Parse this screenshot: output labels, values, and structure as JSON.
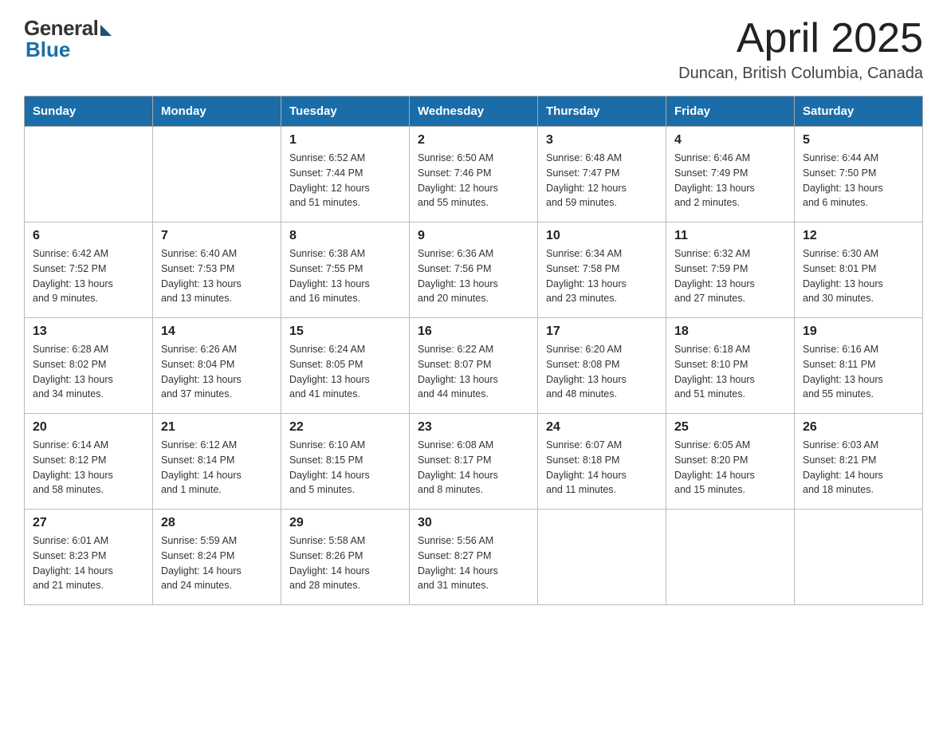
{
  "header": {
    "logo_general": "General",
    "logo_blue": "Blue",
    "title": "April 2025",
    "subtitle": "Duncan, British Columbia, Canada"
  },
  "weekdays": [
    "Sunday",
    "Monday",
    "Tuesday",
    "Wednesday",
    "Thursday",
    "Friday",
    "Saturday"
  ],
  "weeks": [
    [
      {
        "day": "",
        "sunrise": "",
        "sunset": "",
        "daylight": ""
      },
      {
        "day": "",
        "sunrise": "",
        "sunset": "",
        "daylight": ""
      },
      {
        "day": "1",
        "sunrise": "Sunrise: 6:52 AM",
        "sunset": "Sunset: 7:44 PM",
        "daylight": "Daylight: 12 hours and 51 minutes."
      },
      {
        "day": "2",
        "sunrise": "Sunrise: 6:50 AM",
        "sunset": "Sunset: 7:46 PM",
        "daylight": "Daylight: 12 hours and 55 minutes."
      },
      {
        "day": "3",
        "sunrise": "Sunrise: 6:48 AM",
        "sunset": "Sunset: 7:47 PM",
        "daylight": "Daylight: 12 hours and 59 minutes."
      },
      {
        "day": "4",
        "sunrise": "Sunrise: 6:46 AM",
        "sunset": "Sunset: 7:49 PM",
        "daylight": "Daylight: 13 hours and 2 minutes."
      },
      {
        "day": "5",
        "sunrise": "Sunrise: 6:44 AM",
        "sunset": "Sunset: 7:50 PM",
        "daylight": "Daylight: 13 hours and 6 minutes."
      }
    ],
    [
      {
        "day": "6",
        "sunrise": "Sunrise: 6:42 AM",
        "sunset": "Sunset: 7:52 PM",
        "daylight": "Daylight: 13 hours and 9 minutes."
      },
      {
        "day": "7",
        "sunrise": "Sunrise: 6:40 AM",
        "sunset": "Sunset: 7:53 PM",
        "daylight": "Daylight: 13 hours and 13 minutes."
      },
      {
        "day": "8",
        "sunrise": "Sunrise: 6:38 AM",
        "sunset": "Sunset: 7:55 PM",
        "daylight": "Daylight: 13 hours and 16 minutes."
      },
      {
        "day": "9",
        "sunrise": "Sunrise: 6:36 AM",
        "sunset": "Sunset: 7:56 PM",
        "daylight": "Daylight: 13 hours and 20 minutes."
      },
      {
        "day": "10",
        "sunrise": "Sunrise: 6:34 AM",
        "sunset": "Sunset: 7:58 PM",
        "daylight": "Daylight: 13 hours and 23 minutes."
      },
      {
        "day": "11",
        "sunrise": "Sunrise: 6:32 AM",
        "sunset": "Sunset: 7:59 PM",
        "daylight": "Daylight: 13 hours and 27 minutes."
      },
      {
        "day": "12",
        "sunrise": "Sunrise: 6:30 AM",
        "sunset": "Sunset: 8:01 PM",
        "daylight": "Daylight: 13 hours and 30 minutes."
      }
    ],
    [
      {
        "day": "13",
        "sunrise": "Sunrise: 6:28 AM",
        "sunset": "Sunset: 8:02 PM",
        "daylight": "Daylight: 13 hours and 34 minutes."
      },
      {
        "day": "14",
        "sunrise": "Sunrise: 6:26 AM",
        "sunset": "Sunset: 8:04 PM",
        "daylight": "Daylight: 13 hours and 37 minutes."
      },
      {
        "day": "15",
        "sunrise": "Sunrise: 6:24 AM",
        "sunset": "Sunset: 8:05 PM",
        "daylight": "Daylight: 13 hours and 41 minutes."
      },
      {
        "day": "16",
        "sunrise": "Sunrise: 6:22 AM",
        "sunset": "Sunset: 8:07 PM",
        "daylight": "Daylight: 13 hours and 44 minutes."
      },
      {
        "day": "17",
        "sunrise": "Sunrise: 6:20 AM",
        "sunset": "Sunset: 8:08 PM",
        "daylight": "Daylight: 13 hours and 48 minutes."
      },
      {
        "day": "18",
        "sunrise": "Sunrise: 6:18 AM",
        "sunset": "Sunset: 8:10 PM",
        "daylight": "Daylight: 13 hours and 51 minutes."
      },
      {
        "day": "19",
        "sunrise": "Sunrise: 6:16 AM",
        "sunset": "Sunset: 8:11 PM",
        "daylight": "Daylight: 13 hours and 55 minutes."
      }
    ],
    [
      {
        "day": "20",
        "sunrise": "Sunrise: 6:14 AM",
        "sunset": "Sunset: 8:12 PM",
        "daylight": "Daylight: 13 hours and 58 minutes."
      },
      {
        "day": "21",
        "sunrise": "Sunrise: 6:12 AM",
        "sunset": "Sunset: 8:14 PM",
        "daylight": "Daylight: 14 hours and 1 minute."
      },
      {
        "day": "22",
        "sunrise": "Sunrise: 6:10 AM",
        "sunset": "Sunset: 8:15 PM",
        "daylight": "Daylight: 14 hours and 5 minutes."
      },
      {
        "day": "23",
        "sunrise": "Sunrise: 6:08 AM",
        "sunset": "Sunset: 8:17 PM",
        "daylight": "Daylight: 14 hours and 8 minutes."
      },
      {
        "day": "24",
        "sunrise": "Sunrise: 6:07 AM",
        "sunset": "Sunset: 8:18 PM",
        "daylight": "Daylight: 14 hours and 11 minutes."
      },
      {
        "day": "25",
        "sunrise": "Sunrise: 6:05 AM",
        "sunset": "Sunset: 8:20 PM",
        "daylight": "Daylight: 14 hours and 15 minutes."
      },
      {
        "day": "26",
        "sunrise": "Sunrise: 6:03 AM",
        "sunset": "Sunset: 8:21 PM",
        "daylight": "Daylight: 14 hours and 18 minutes."
      }
    ],
    [
      {
        "day": "27",
        "sunrise": "Sunrise: 6:01 AM",
        "sunset": "Sunset: 8:23 PM",
        "daylight": "Daylight: 14 hours and 21 minutes."
      },
      {
        "day": "28",
        "sunrise": "Sunrise: 5:59 AM",
        "sunset": "Sunset: 8:24 PM",
        "daylight": "Daylight: 14 hours and 24 minutes."
      },
      {
        "day": "29",
        "sunrise": "Sunrise: 5:58 AM",
        "sunset": "Sunset: 8:26 PM",
        "daylight": "Daylight: 14 hours and 28 minutes."
      },
      {
        "day": "30",
        "sunrise": "Sunrise: 5:56 AM",
        "sunset": "Sunset: 8:27 PM",
        "daylight": "Daylight: 14 hours and 31 minutes."
      },
      {
        "day": "",
        "sunrise": "",
        "sunset": "",
        "daylight": ""
      },
      {
        "day": "",
        "sunrise": "",
        "sunset": "",
        "daylight": ""
      },
      {
        "day": "",
        "sunrise": "",
        "sunset": "",
        "daylight": ""
      }
    ]
  ]
}
